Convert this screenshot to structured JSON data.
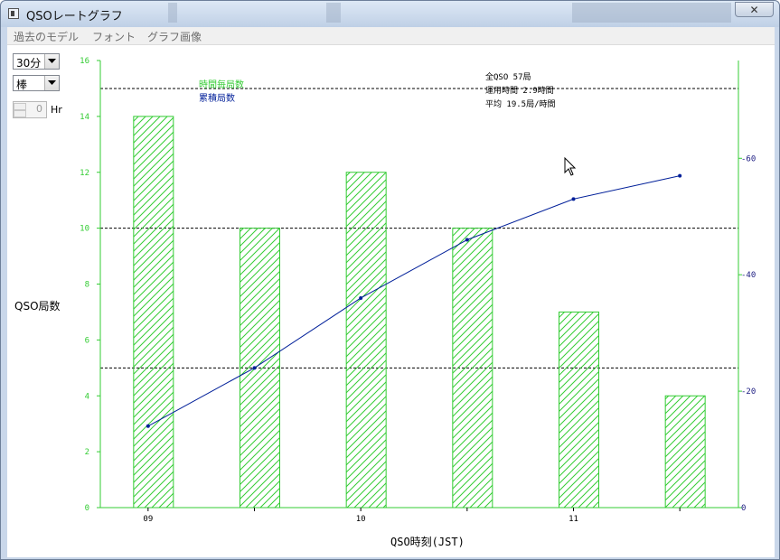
{
  "window": {
    "title": "QSOレートグラフ",
    "close_glyph": "✕"
  },
  "menu": {
    "items": [
      "過去のモデル",
      "フォント",
      "グラフ画像"
    ]
  },
  "controls": {
    "interval": {
      "value": "30分"
    },
    "style": {
      "value": "棒"
    },
    "hours": {
      "value": "0",
      "unit": "Hr"
    }
  },
  "colors": {
    "bar": "#33cc33",
    "line": "#001f99",
    "grid": "#000000",
    "axis": "#33cc33"
  },
  "stats": {
    "total": "全QSO 57局",
    "time": "運用時間 2.9時間",
    "average": "平均 19.5局/時間"
  },
  "chart_data": {
    "type": "bar",
    "categories": [
      "09",
      "",
      "10",
      "",
      "11",
      ""
    ],
    "xlabel": "QSO時刻(JST)",
    "ylabel": "QSO局数",
    "left_ticks": [
      "0",
      "2",
      "4",
      "6",
      "8",
      "10",
      "12",
      "14",
      "16"
    ],
    "right_ticks": [
      "0",
      "20",
      "40",
      "60"
    ],
    "ylim": [
      0,
      16
    ],
    "ylim_right": [
      0,
      76.8
    ],
    "gridlines": [
      5,
      10,
      15
    ],
    "series": [
      {
        "name": "時間毎局数",
        "type": "bar",
        "axis": "left",
        "values": [
          14,
          10,
          12,
          10,
          7,
          4
        ]
      },
      {
        "name": "累積局数",
        "type": "line",
        "axis": "right",
        "values": [
          14,
          24,
          36,
          46,
          53,
          57
        ]
      }
    ]
  }
}
